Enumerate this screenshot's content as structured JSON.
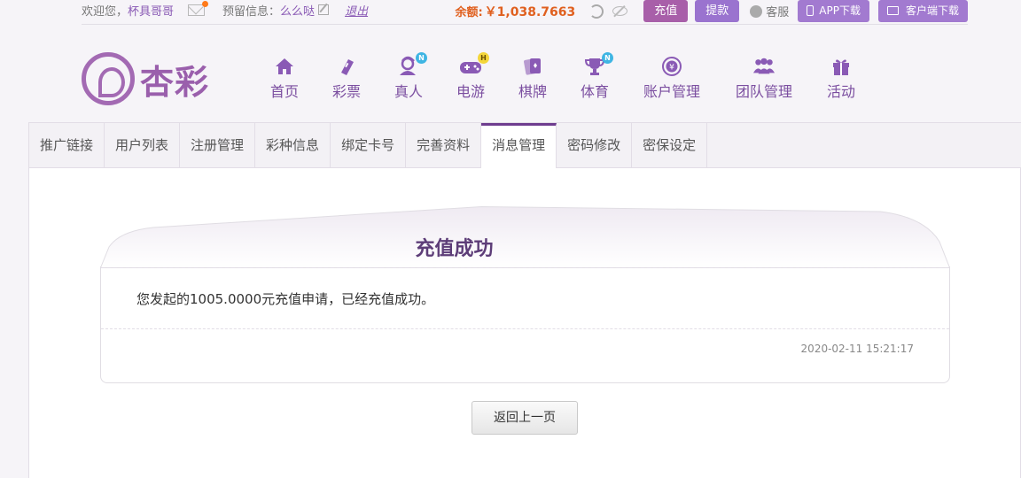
{
  "topbar": {
    "welcome": "欢迎您，",
    "username": "杯具哥哥",
    "reserved_label": "预留信息：",
    "reserved_value": "么么哒",
    "logout": "退出",
    "balance_label": "余额:",
    "balance_value": "￥1,038.7663",
    "recharge": "充值",
    "withdraw": "提款",
    "service": "客服",
    "app_download": "APP下载",
    "client_download": "客户端下载"
  },
  "logo": {
    "text": "杏彩"
  },
  "nav": [
    {
      "label": "首页",
      "icon": "home-icon"
    },
    {
      "label": "彩票",
      "icon": "lottery-icon"
    },
    {
      "label": "真人",
      "icon": "live-icon",
      "badge": "N"
    },
    {
      "label": "电游",
      "icon": "gamepad-icon",
      "badge": "H"
    },
    {
      "label": "棋牌",
      "icon": "cards-icon"
    },
    {
      "label": "体育",
      "icon": "trophy-icon",
      "badge": "N"
    },
    {
      "label": "账户管理",
      "icon": "account-icon"
    },
    {
      "label": "团队管理",
      "icon": "team-icon"
    },
    {
      "label": "活动",
      "icon": "gift-icon"
    }
  ],
  "tabs": [
    "推广链接",
    "用户列表",
    "注册管理",
    "彩种信息",
    "绑定卡号",
    "完善资料",
    "消息管理",
    "密码修改",
    "密保设定"
  ],
  "message": {
    "title": "充值成功",
    "body": "您发起的1005.0000元充值申请，已经充值成功。",
    "time": "2020-02-11 15:21:17"
  },
  "back_button": "返回上一页",
  "colors": {
    "accent": "#a36ab3",
    "balance": "#e0601f",
    "tab_active": "#6e3d8f"
  }
}
